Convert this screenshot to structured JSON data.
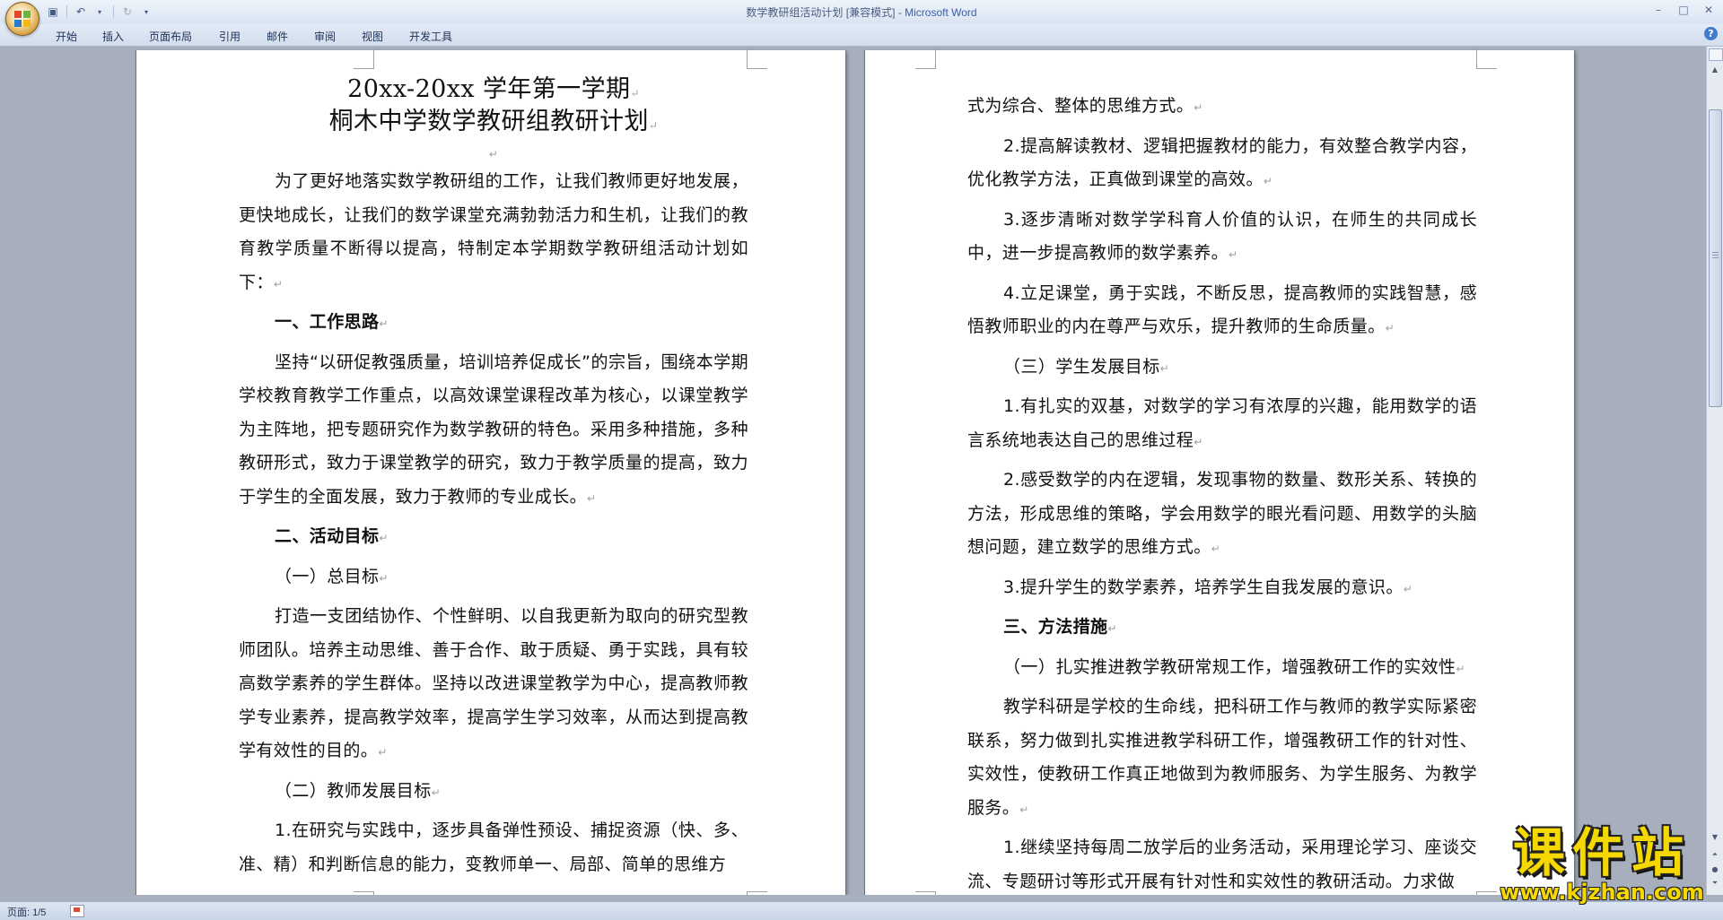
{
  "window": {
    "title_doc": "数学教研组活动计划 [兼容模式]",
    "title_sep": " - ",
    "title_app": "Microsoft Word"
  },
  "ribbon": {
    "tabs": [
      "开始",
      "插入",
      "页面布局",
      "引用",
      "邮件",
      "审阅",
      "视图",
      "开发工具"
    ]
  },
  "help": "?",
  "status": {
    "page": "页面: 1/5"
  },
  "watermark": {
    "main": "课件站",
    "url": "www.kjzhan.com"
  },
  "page1": {
    "title1": "20xx-20xx 学年第一学期",
    "title2": "桐木中学数学教研组教研计划",
    "intro": "为了更好地落实数学教研组的工作，让我们教师更好地发展，更快地成长，让我们的数学课堂充满勃勃活力和生机，让我们的教育教学质量不断得以提高，特制定本学期数学教研组活动计划如下：",
    "h1": "一、工作思路",
    "p_idea": "坚持“以研促教强质量，培训培养促成长”的宗旨，围绕本学期学校教育教学工作重点，以高效课堂课程改革为核心，以课堂教学为主阵地，把专题研究作为数学教研的特色。采用多种措施，多种教研形式，致力于课堂教学的研究，致力于教学质量的提高，致力于学生的全面发展，致力于教师的专业成长。",
    "h2": "二、活动目标",
    "sub1": "（一）总目标",
    "p_goal": "打造一支团结协作、个性鲜明、以自我更新为取向的研究型教师团队。培养主动思维、善于合作、敢于质疑、勇于实践，具有较高数学素养的学生群体。坚持以改进课堂教学为中心，提高教师教学专业素养，提高教学效率，提高学生学习效率，从而达到提高教学有效性的目的。",
    "sub2": "（二）教师发展目标",
    "p_t1": "1.在研究与实践中，逐步具备弹性预设、捕捉资源（快、多、准、精）和判断信息的能力，变教师单一、局部、简单的思维方"
  },
  "page2": {
    "p_cont": "式为综合、整体的思维方式。",
    "p_t2": "2.提高解读教材、逻辑把握教材的能力，有效整合教学内容，优化教学方法，正真做到课堂的高效。",
    "p_t3": "3.逐步清晰对数学学科育人价值的认识，在师生的共同成长中，进一步提高教师的数学素养。",
    "p_t4": "4.立足课堂，勇于实践，不断反思，提高教师的实践智慧，感悟教师职业的内在尊严与欢乐，提升教师的生命质量。",
    "sub3": "（三）学生发展目标",
    "p_s1": "1.有扎实的双基，对数学的学习有浓厚的兴趣，能用数学的语言系统地表达自己的思维过程",
    "p_s2": "2.感受数学的内在逻辑，发现事物的数量、数形关系、转换的方法，形成思维的策略，学会用数学的眼光看问题、用数学的头脑想问题，建立数学的思维方式。",
    "p_s3": "3.提升学生的数学素养，培养学生自我发展的意识。",
    "h3": "三、方法措施",
    "sub4": "（一）扎实推进教学教研常规工作，增强教研工作的实效性",
    "p_m1": "教学科研是学校的生命线，把科研工作与教师的教学实际紧密联系，努力做到扎实推进教学科研工作，增强教研工作的针对性、实效性，使教研工作真正地做到为教师服务、为学生服务、为教学服务。",
    "p_m2": "1.继续坚持每周二放学后的业务活动，采用理论学习、座谈交流、专题研讨等形式开展有针对性和实效性的教研活动。力求做"
  },
  "marks": {
    "para": "↵"
  },
  "colors": {
    "watermark": "#f5d800",
    "title_app": "#3b5fa3",
    "workspace": "#a7afbc"
  }
}
